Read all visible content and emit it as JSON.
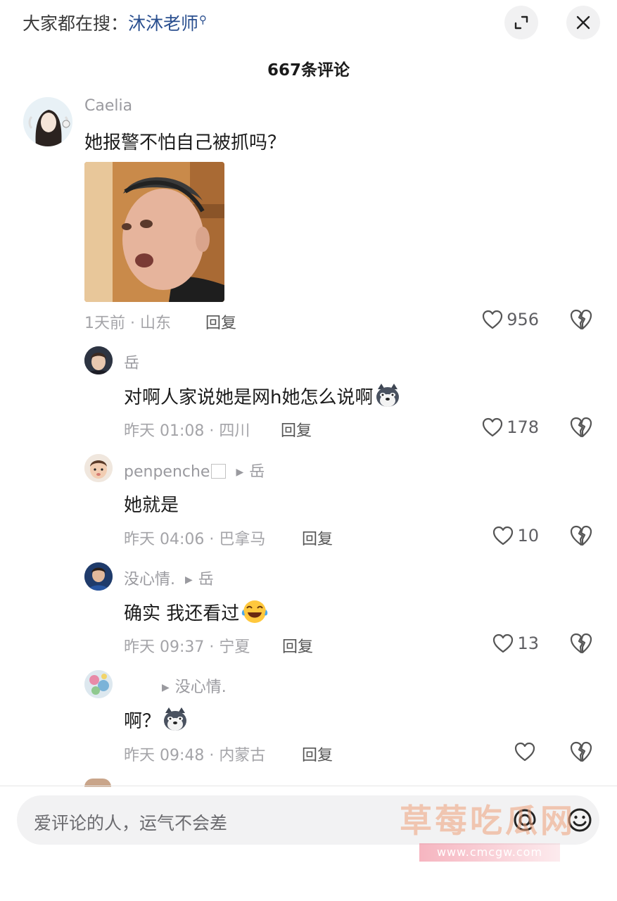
{
  "header": {
    "search_prefix": "大家都在搜：",
    "search_keyword": "沐沐老师",
    "expand_icon": "expand-icon",
    "close_icon": "close-icon"
  },
  "comment_count_title": "667条评论",
  "comments": [
    {
      "username": "Caelia",
      "text": "她报警不怕自己被抓吗？",
      "has_image": true,
      "meta": "1天前 · 山东",
      "reply_label": "回复",
      "likes": "956"
    },
    {
      "username": "岳",
      "text": "对啊人家说她是网h她怎么说啊",
      "emoji": "husky-face-emoji",
      "meta": "昨天 01:08 · 四川",
      "reply_label": "回复",
      "likes": "178"
    },
    {
      "username": "penpenche",
      "reply_to": "岳",
      "text": "她就是",
      "meta": "昨天 04:06 · 巴拿马",
      "reply_label": "回复",
      "likes": "10"
    },
    {
      "username": "没心情.",
      "reply_to": "岳",
      "text": "确实 我还看过",
      "emoji": "laughing-crying-emoji",
      "meta": "昨天 09:37 · 宁夏",
      "reply_label": "回复",
      "likes": "13"
    },
    {
      "username": "",
      "reply_to": "没心情.",
      "text": "啊？",
      "emoji": "husky-face-emoji",
      "meta": "昨天 09:48 · 内蒙古",
      "reply_label": "回复",
      "likes": ""
    }
  ],
  "input": {
    "placeholder": "爱评论的人，运气不会差",
    "at_icon": "at-icon",
    "emoji_icon": "smiley-icon"
  },
  "watermark": {
    "title": "草莓吃瓜网",
    "url": "www.cmcgw.com"
  },
  "colors": {
    "keyword": "#2a4f8f",
    "muted_text": "#9a9a9f",
    "background": "#ffffff"
  }
}
